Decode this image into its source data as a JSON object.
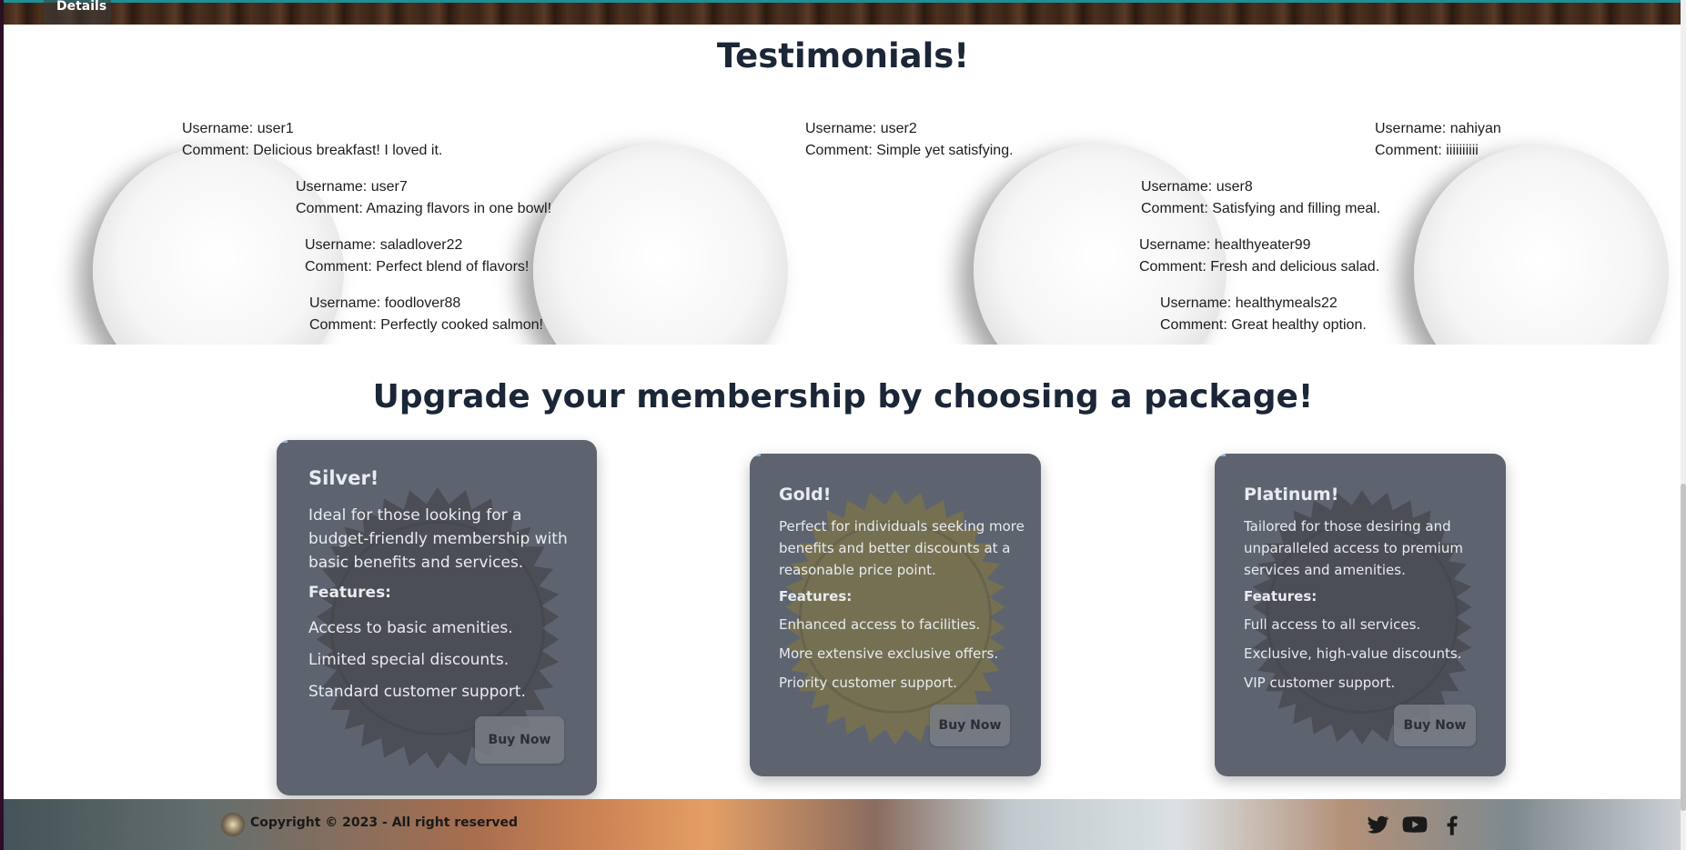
{
  "top_banner": {
    "tab_label": "Details"
  },
  "testimonials": {
    "title": "Testimonials!",
    "username_prefix": "Username: ",
    "comment_prefix": "Comment: ",
    "items": [
      {
        "username": "user1",
        "comment": "Delicious breakfast! I loved it."
      },
      {
        "username": "user7",
        "comment": "Amazing flavors in one bowl!"
      },
      {
        "username": "saladlover22",
        "comment": "Perfect blend of flavors!"
      },
      {
        "username": "foodlover88",
        "comment": "Perfectly cooked salmon!"
      },
      {
        "username": "user2",
        "comment": "Simple yet satisfying."
      },
      {
        "username": "user8",
        "comment": "Satisfying and filling meal."
      },
      {
        "username": "healthyeater99",
        "comment": "Fresh and delicious salad."
      },
      {
        "username": "healthymeals22",
        "comment": "Great healthy option."
      },
      {
        "username": "nahiyan",
        "comment": "iiiiiiiiii"
      }
    ]
  },
  "membership": {
    "title": "Upgrade your membership by choosing a package!",
    "features_label": "Features:",
    "buy_label": "Buy Now",
    "packages": [
      {
        "name": "Silver!",
        "description": "Ideal for those looking for a budget-friendly membership with basic benefits and services.",
        "features": [
          "Access to basic amenities.",
          "Limited special discounts.",
          "Standard customer support."
        ],
        "seal_color": "#3f3f3f"
      },
      {
        "name": "Gold!",
        "description": "Perfect for individuals seeking more benefits and better discounts at a reasonable price point.",
        "features": [
          "Enhanced access to facilities.",
          "More extensive exclusive offers.",
          "Priority customer support."
        ],
        "seal_color": "#8a7a3a"
      },
      {
        "name": "Platinum!",
        "description": "Tailored for those desiring and unparalleled access to premium services and amenities.",
        "features": [
          "Full access to all services.",
          "Exclusive, high-value discounts.",
          "VIP customer support."
        ],
        "seal_color": "#3a3a3a"
      }
    ]
  },
  "footer": {
    "copyright": "Copyright © 2023 - All right reserved",
    "social_icons": [
      "twitter-icon",
      "youtube-icon",
      "facebook-icon"
    ]
  }
}
